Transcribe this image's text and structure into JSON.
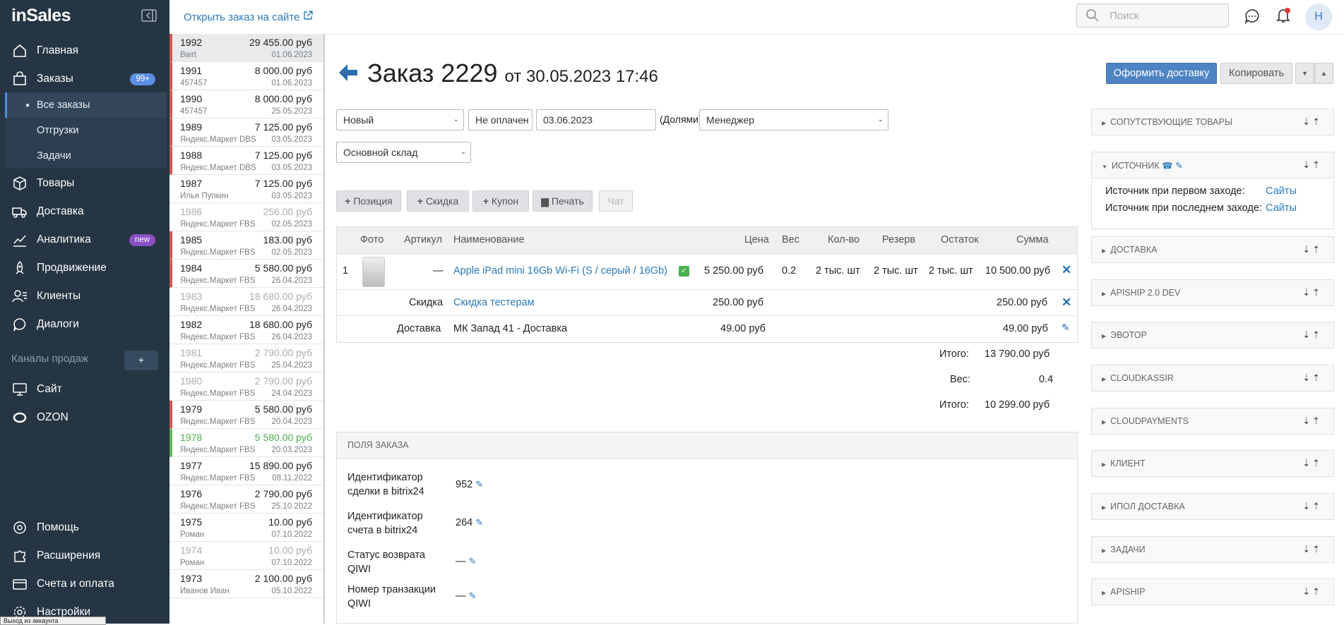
{
  "brand": "inSales",
  "nav": {
    "items": [
      {
        "label": "Главная",
        "icon": "home-icon"
      },
      {
        "label": "Заказы",
        "icon": "bag-icon",
        "badge": "99+"
      },
      {
        "label": "Товары",
        "icon": "box-icon"
      },
      {
        "label": "Доставка",
        "icon": "truck-icon"
      },
      {
        "label": "Аналитика",
        "icon": "chart-icon",
        "badge": "new"
      },
      {
        "label": "Продвижение",
        "icon": "rocket-icon"
      },
      {
        "label": "Клиенты",
        "icon": "users-icon"
      },
      {
        "label": "Диалоги",
        "icon": "chat-icon"
      }
    ],
    "sub": [
      "Все заказы",
      "Отгрузки",
      "Задачи"
    ],
    "channels_label": "Каналы продаж",
    "channels_plus": "+",
    "channels": [
      {
        "label": "Сайт",
        "icon": "monitor-icon"
      },
      {
        "label": "OZON",
        "icon": "ozon-icon"
      }
    ],
    "bottom": [
      {
        "label": "Помощь",
        "icon": "help-icon"
      },
      {
        "label": "Расширения",
        "icon": "puzzle-icon"
      },
      {
        "label": "Счета и оплата",
        "icon": "card-icon"
      },
      {
        "label": "Настройки",
        "icon": "gear-icon"
      }
    ],
    "tooltip": "Выход из аккаунта"
  },
  "topbar": {
    "open_link": "Открыть заказ на сайте",
    "search_placeholder": "Поиск",
    "avatar": "Н"
  },
  "orders": [
    {
      "n": "1992",
      "p": "29 455.00 руб",
      "s": "Bwrt",
      "d": "01.06.2023",
      "st": "sel"
    },
    {
      "n": "1991",
      "p": "8 000.00 руб",
      "s": "457457",
      "d": "01.06.2023",
      "st": "red"
    },
    {
      "n": "1990",
      "p": "8 000.00 руб",
      "s": "457457",
      "d": "25.05.2023",
      "st": "red"
    },
    {
      "n": "1989",
      "p": "7 125.00 руб",
      "s": "Яндекс.Маркет DBS",
      "d": "03.05.2023",
      "st": "red"
    },
    {
      "n": "1988",
      "p": "7 125.00 руб",
      "s": "Яндекс.Маркет DBS",
      "d": "03.05.2023",
      "st": "red"
    },
    {
      "n": "1987",
      "p": "7 125.00 руб",
      "s": "Илья Пупкин",
      "d": "03.05.2023",
      "st": ""
    },
    {
      "n": "1986",
      "p": "256.00 руб",
      "s": "Яндекс.Маркет FBS",
      "d": "02.05.2023",
      "st": "grey"
    },
    {
      "n": "1985",
      "p": "183.00 руб",
      "s": "Яндекс.Маркет FBS",
      "d": "02.05.2023",
      "st": "red"
    },
    {
      "n": "1984",
      "p": "5 580.00 руб",
      "s": "Яндекс.Маркет FBS",
      "d": "26.04.2023",
      "st": "red"
    },
    {
      "n": "1983",
      "p": "18 680.00 руб",
      "s": "Яндекс.Маркет FBS",
      "d": "26.04.2023",
      "st": "grey"
    },
    {
      "n": "1982",
      "p": "18 680.00 руб",
      "s": "Яндекс.Маркет FBS",
      "d": "26.04.2023",
      "st": ""
    },
    {
      "n": "1981",
      "p": "2 790.00 руб",
      "s": "Яндекс.Маркет FBS",
      "d": "25.04.2023",
      "st": "grey"
    },
    {
      "n": "1980",
      "p": "2 790.00 руб",
      "s": "Яндекс.Маркет FBS",
      "d": "24.04.2023",
      "st": "grey"
    },
    {
      "n": "1979",
      "p": "5 580.00 руб",
      "s": "Яндекс.Маркет FBS",
      "d": "20.04.2023",
      "st": "red"
    },
    {
      "n": "1978",
      "p": "5 580.00 руб",
      "s": "Яндекс.Маркет FBS",
      "d": "20.03.2023",
      "st": "gr"
    },
    {
      "n": "1977",
      "p": "15 890.00 руб",
      "s": "Яндекс.Маркет FBS",
      "d": "08.11.2022",
      "st": ""
    },
    {
      "n": "1976",
      "p": "2 790.00 руб",
      "s": "Яндекс.Маркет FBS",
      "d": "25.10.2022",
      "st": ""
    },
    {
      "n": "1975",
      "p": "10.00 руб",
      "s": "Роман",
      "d": "07.10.2022",
      "st": ""
    },
    {
      "n": "1974",
      "p": "10.00 руб",
      "s": "Роман",
      "d": "07.10.2022",
      "st": "grey"
    },
    {
      "n": "1973",
      "p": "2 100.00 руб",
      "s": "Иванов Иван",
      "d": "05.10.2022",
      "st": ""
    }
  ],
  "order": {
    "title": "Заказ 2229",
    "date": "от 30.05.2023 17:46",
    "btn_ship": "Оформить доставку",
    "btn_copy": "Копировать",
    "status": "Новый",
    "payment": "Не оплачен",
    "ship_date": "03.06.2023",
    "pay_method": "(Долями)",
    "manager": "Менеджер",
    "warehouse": "Основной склад",
    "toolbar": {
      "position": "Позиция",
      "discount": "Скидка",
      "coupon": "Купон",
      "print": "Печать",
      "chat": "Чат"
    },
    "columns": [
      "Фото",
      "Артикул",
      "Наименование",
      "Цена",
      "Вес",
      "Кол-во",
      "Резерв",
      "Остаток",
      "Сумма"
    ],
    "item": {
      "idx": "1",
      "sku": "—",
      "name": "Apple iPad mini 16Gb Wi-Fi (S / серый / 16Gb)",
      "price": "5 250.00 руб",
      "weight": "0.2",
      "qty": "2 тыс. шт",
      "reserve": "2 тыс. шт",
      "stock": "2 тыс. шт",
      "sum": "10 500.00 руб"
    },
    "discount_row": {
      "label": "Скидка",
      "name": "Скидка тестерам",
      "price": "250.00 руб",
      "sum": "250.00 руб"
    },
    "delivery_row": {
      "label": "Доставка",
      "name": "МК Запад 41 - Доставка",
      "price": "49.00 руб",
      "sum": "49.00 руб"
    },
    "totals": [
      {
        "label": "Итого:",
        "value": "13 790.00 руб"
      },
      {
        "label": "Вес:",
        "value": "0.4"
      },
      {
        "label": "Итого:",
        "value": "10 299.00 руб"
      }
    ],
    "fields_title": "ПОЛЯ ЗАКАЗА",
    "fields": [
      {
        "label": "Идентификатор сделки в bitrix24",
        "value": "952"
      },
      {
        "label": "Идентификатор счета в bitrix24",
        "value": "264"
      },
      {
        "label": "Статус возврата QIWI",
        "value": "—"
      },
      {
        "label": "Номер транзакции QIWI",
        "value": "—"
      }
    ]
  },
  "panels": [
    "Сопутствующие товары",
    "Источник",
    "Доставка",
    "ApiShip 2.0 DEV",
    "Эвотор",
    "CloudKassir",
    "CloudPayments",
    "Клиент",
    "ИПОЛ доставка",
    "Задачи",
    "ApiShip"
  ],
  "source": {
    "first_label": "Источник при первом заходе:",
    "first_val": "Сайты",
    "last_label": "Источник при последнем заходе:",
    "last_val": "Сайты"
  },
  "colors": {
    "sidebar": "#253543",
    "accent": "#4f84c4",
    "link": "#2a7ab8"
  }
}
